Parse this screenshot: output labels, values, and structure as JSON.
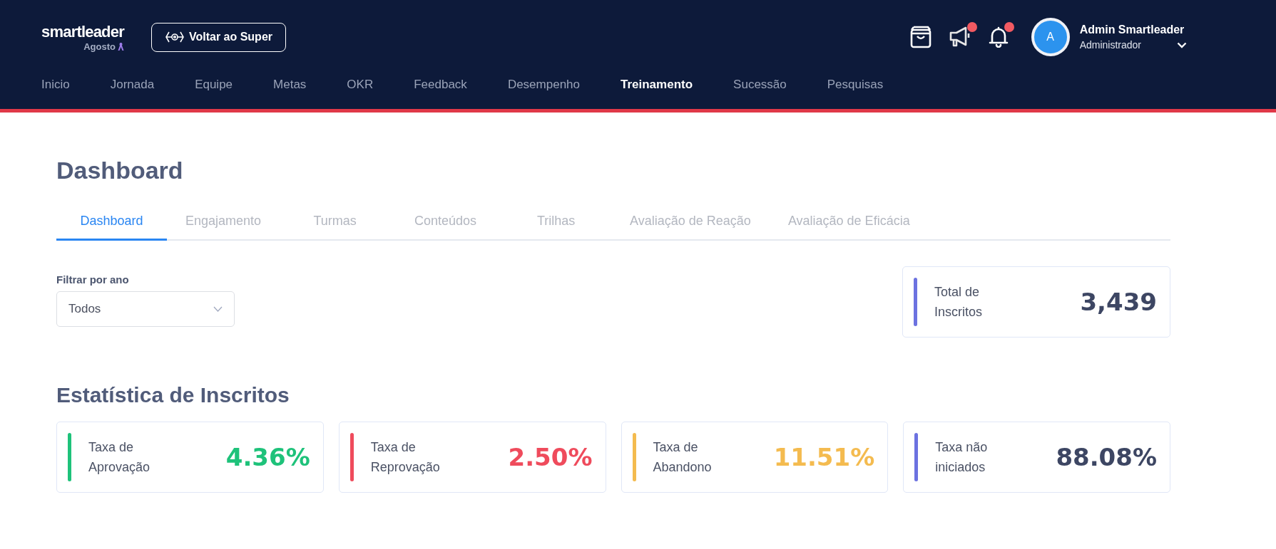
{
  "header": {
    "logo": "smartleader",
    "logo_subtitle": "Agosto",
    "back_button": "Voltar ao Super",
    "icons": [
      {
        "kind": "bag",
        "badge": false
      },
      {
        "kind": "megaphone",
        "badge": true
      },
      {
        "kind": "bell",
        "badge": true
      }
    ],
    "user": {
      "avatar": "A",
      "name": "Admin Smartleader",
      "role": "Administrador"
    },
    "nav": [
      {
        "label": "Inicio",
        "selected": false
      },
      {
        "label": "Jornada",
        "selected": false
      },
      {
        "label": "Equipe",
        "selected": false
      },
      {
        "label": "Metas",
        "selected": false
      },
      {
        "label": "OKR",
        "selected": false
      },
      {
        "label": "Feedback",
        "selected": false
      },
      {
        "label": "Desempenho",
        "selected": false
      },
      {
        "label": "Treinamento",
        "selected": true
      },
      {
        "label": "Sucessão",
        "selected": false
      },
      {
        "label": "Pesquisas",
        "selected": false
      }
    ]
  },
  "page_title": "Dashboard",
  "tabs": [
    {
      "label": "Dashboard",
      "selected": true
    },
    {
      "label": "Engajamento",
      "selected": false
    },
    {
      "label": "Turmas",
      "selected": false
    },
    {
      "label": "Conteúdos",
      "selected": false
    },
    {
      "label": "Trilhas",
      "selected": false
    },
    {
      "label": "Avaliação de Reação",
      "selected": false
    },
    {
      "label": "Avaliação de Eficácia",
      "selected": false
    }
  ],
  "filter": {
    "label": "Filtrar por ano",
    "value": "Todos"
  },
  "total_card": {
    "label": "Total de Inscritos",
    "value": "3,439",
    "color": "#6c72e0"
  },
  "section_title": "Estatística de Inscritos",
  "stats": [
    {
      "label": "Taxa de Aprovação",
      "value": "4.36%",
      "color": "#1ec27a"
    },
    {
      "label": "Taxa de Reprovação",
      "value": "2.50%",
      "color": "#ef4b5c"
    },
    {
      "label": "Taxa de Abandono",
      "value": "11.51%",
      "color": "#f4bb4f"
    },
    {
      "label": "Taxa não iniciados",
      "value": "88.08%",
      "color": "#6c72e0"
    }
  ]
}
